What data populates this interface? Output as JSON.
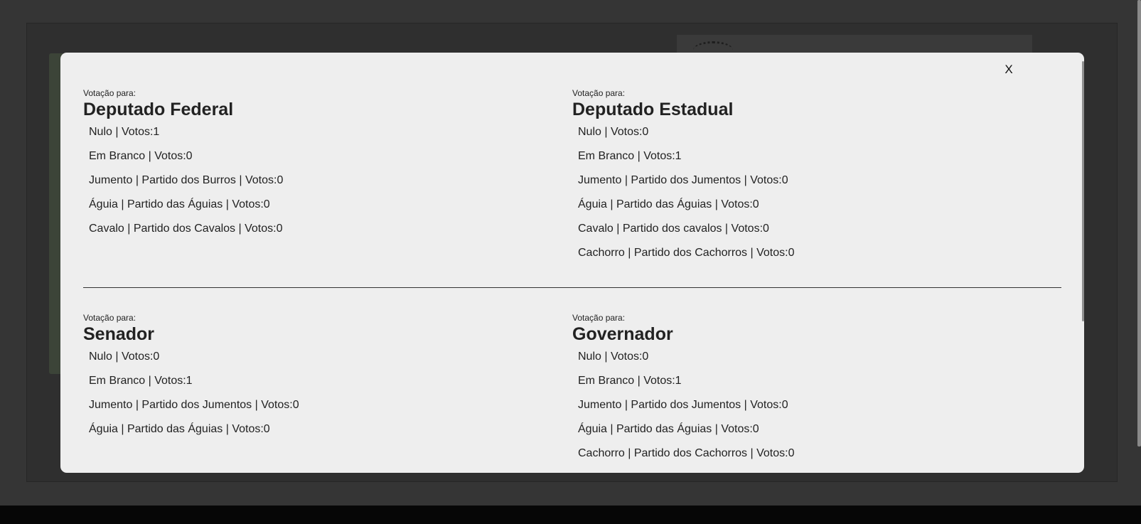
{
  "modal": {
    "close_label": "X",
    "sections": [
      {
        "vote_for_label": "Votação para:",
        "office": "Deputado Federal",
        "results": [
          "Nulo | Votos:1",
          "Em Branco | Votos:0",
          "Jumento | Partido dos Burros | Votos:0",
          "Águia | Partido das Águias | Votos:0",
          "Cavalo | Partido dos Cavalos | Votos:0"
        ]
      },
      {
        "vote_for_label": "Votação para:",
        "office": "Deputado Estadual",
        "results": [
          "Nulo | Votos:0",
          "Em Branco | Votos:1",
          "Jumento | Partido dos Jumentos | Votos:0",
          "Águia | Partido das Águias | Votos:0",
          "Cavalo | Partido dos cavalos | Votos:0",
          "Cachorro | Partido dos Cachorros | Votos:0"
        ]
      },
      {
        "vote_for_label": "Votação para:",
        "office": "Senador",
        "results": [
          "Nulo | Votos:0",
          "Em Branco | Votos:1",
          "Jumento | Partido dos Jumentos | Votos:0",
          "Águia | Partido das Águias | Votos:0"
        ]
      },
      {
        "vote_for_label": "Votação para:",
        "office": "Governador",
        "results": [
          "Nulo | Votos:0",
          "Em Branco | Votos:1",
          "Jumento | Partido dos Jumentos | Votos:0",
          "Águia | Partido das Águias | Votos:0",
          "Cachorro | Partido dos Cachorros | Votos:0"
        ]
      }
    ]
  }
}
